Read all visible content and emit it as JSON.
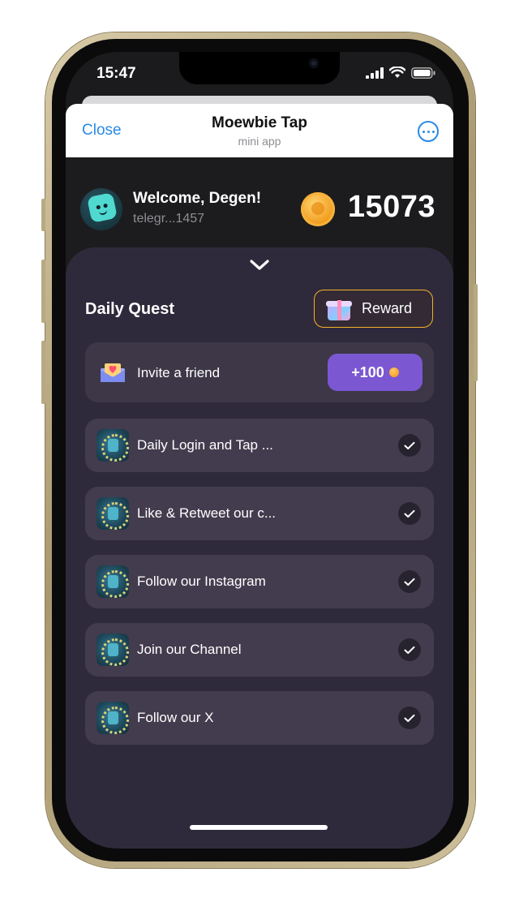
{
  "status_bar": {
    "time": "15:47"
  },
  "telegram_header": {
    "close_label": "Close",
    "title": "Moewbie Tap",
    "subtitle": "mini app"
  },
  "profile": {
    "greeting": "Welcome, Degen!",
    "handle": "telegr...1457",
    "balance": "15073"
  },
  "daily_quest": {
    "title": "Daily Quest",
    "reward_label": "Reward",
    "quests": [
      {
        "label": "Invite a friend",
        "action": "+100",
        "status": "claimable",
        "icon": "envelope-heart-icon"
      },
      {
        "label": "Daily Login and Tap ...",
        "status": "completed",
        "icon": "quest-badge-icon"
      },
      {
        "label": "Like & Retweet our c...",
        "status": "completed",
        "icon": "quest-badge-icon"
      },
      {
        "label": "Follow our Instagram",
        "status": "completed",
        "icon": "quest-badge-icon"
      },
      {
        "label": "Join our Channel",
        "status": "completed",
        "icon": "quest-badge-icon"
      },
      {
        "label": "Follow our X",
        "status": "completed",
        "icon": "quest-badge-icon"
      }
    ]
  },
  "colors": {
    "telegram_accent": "#2a8ae6",
    "sheet_background": "#2f2a3b",
    "claim_button": "#7b57d1",
    "reward_border": "#f2b226"
  }
}
